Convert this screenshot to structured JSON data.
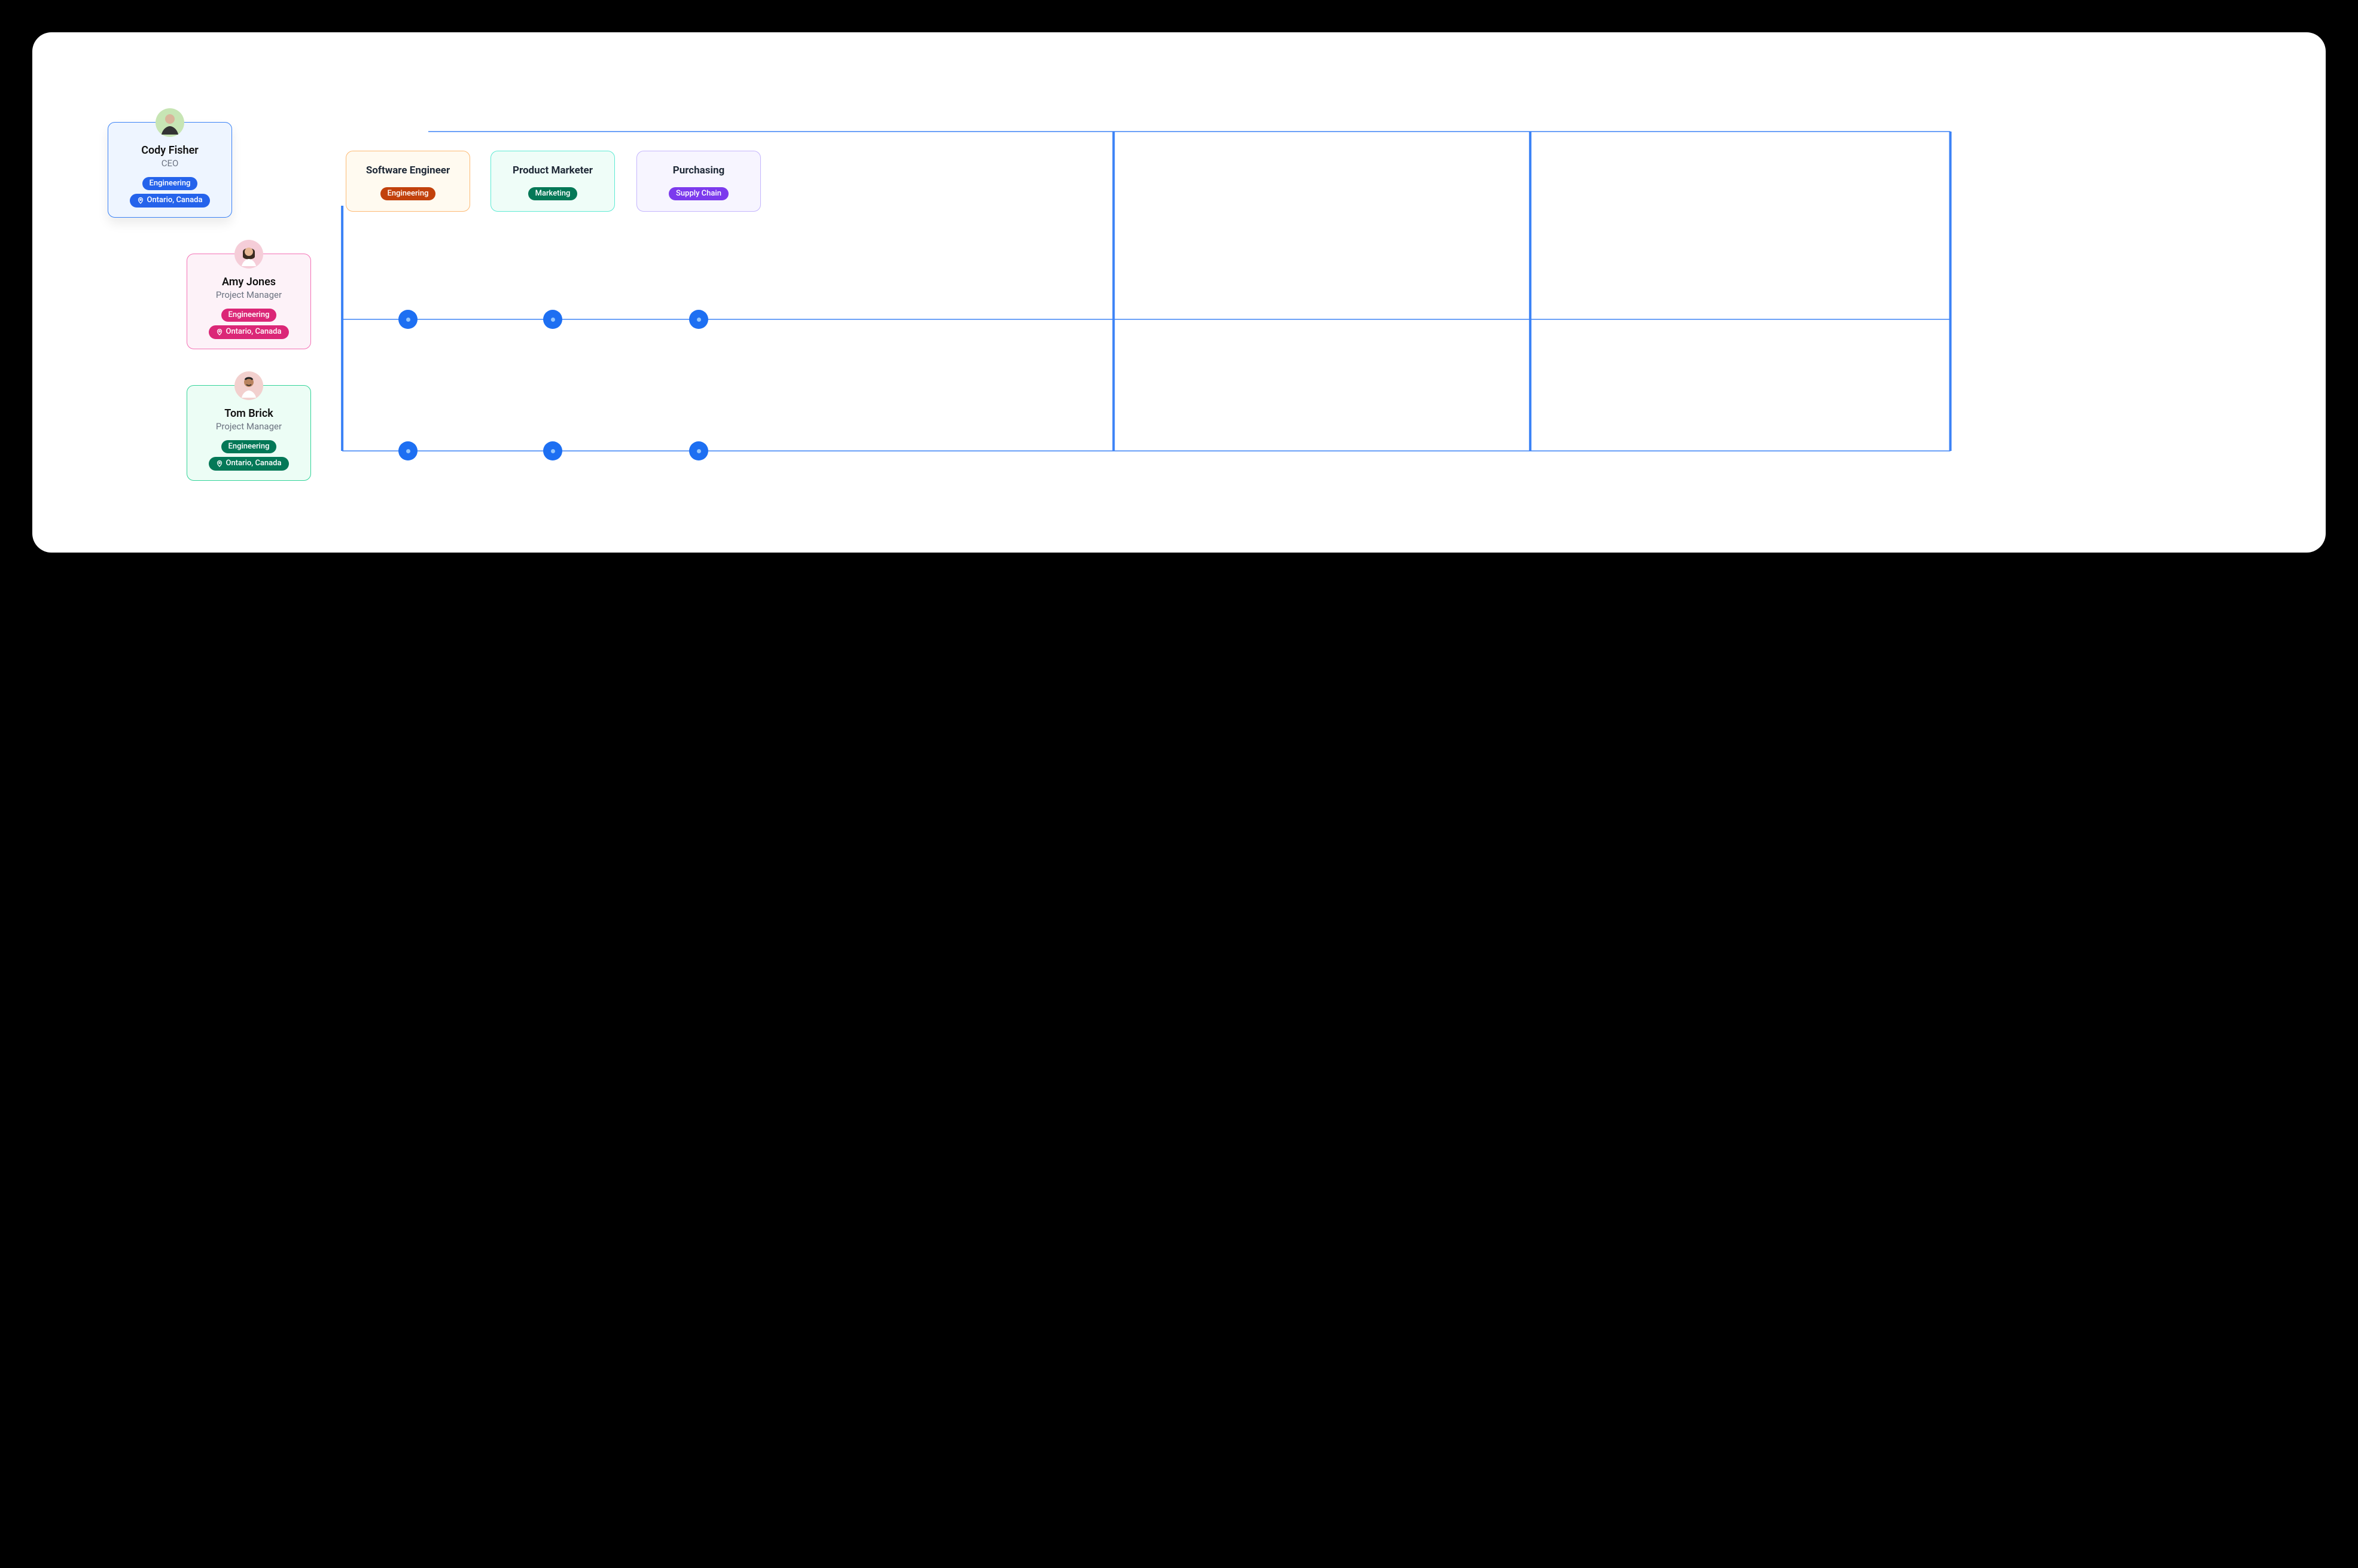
{
  "people": [
    {
      "name": "Cody Fisher",
      "title": "CEO",
      "dept": "Engineering",
      "location": "Ontario, Canada"
    },
    {
      "name": "Amy Jones",
      "title": "Project Manager",
      "dept": "Engineering",
      "location": "Ontario, Canada"
    },
    {
      "name": "Tom Brick",
      "title": "Project Manager",
      "dept": "Engineering",
      "location": "Ontario, Canada"
    }
  ],
  "roles": [
    {
      "name": "Software Engineer",
      "tag": "Engineering"
    },
    {
      "name": "Product Marketer",
      "tag": "Marketing"
    },
    {
      "name": "Purchasing",
      "tag": "Supply Chain"
    }
  ],
  "colors": {
    "connector": "#3b82f6",
    "node": "#1d6ff2"
  }
}
